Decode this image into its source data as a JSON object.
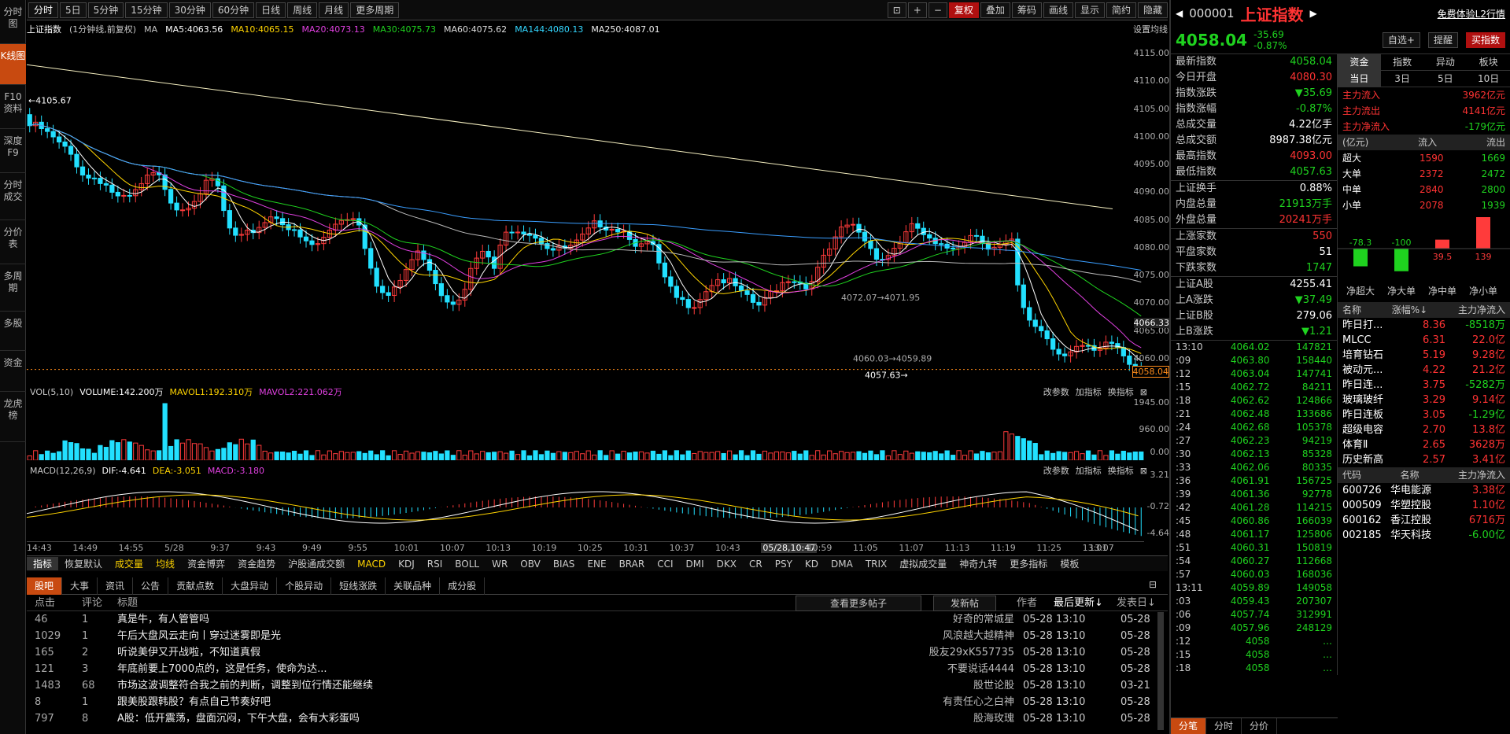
{
  "vtabs": [
    "分时图",
    "K线图",
    "F10资料",
    "深度F9",
    "分时成交",
    "分价表",
    "多周期",
    "多股",
    "资金",
    "龙虎榜"
  ],
  "toolbar": {
    "periods": [
      "分时",
      "5日",
      "5分钟",
      "15分钟",
      "30分钟",
      "60分钟",
      "日线",
      "周线",
      "月线",
      "更多周期"
    ],
    "right": [
      "复权",
      "叠加",
      "筹码",
      "画线",
      "显示",
      "简约",
      "隐藏"
    ]
  },
  "chart_header": {
    "title": "上证指数",
    "subtitle": "(1分钟线,前复权)",
    "ma": "MA",
    "ma5": "MA5:4063.56",
    "ma10": "MA10:4065.15",
    "ma20": "MA20:4073.13",
    "ma30": "MA30:4075.73",
    "ma60": "MA60:4075.62",
    "ma144": "MA144:4080.13",
    "ma250": "MA250:4087.01",
    "settings": "设置均线"
  },
  "vol_header": {
    "vol": "VOL(5,10)",
    "volume": "VOLUME:142.200万",
    "mavol1": "MAVOL1:192.310万",
    "mavol2": "MAVOL2:221.062万",
    "change_param": "改参数",
    "add_ind": "加指标",
    "swap_ind": "换指标"
  },
  "macd_header": {
    "macd": "MACD(12,26,9)",
    "dif": "DIF:-4.641",
    "dea": "DEA:-3.051",
    "macdv": "MACD:-3.180",
    "change_param": "改参数",
    "add_ind": "加指标",
    "swap_ind": "换指标"
  },
  "price_axis": [
    "4115.00",
    "4110.00",
    "4105.00",
    "4100.00",
    "4095.00",
    "4090.00",
    "4085.00",
    "4080.00",
    "4075.00",
    "4070.00",
    "4065.00",
    "4060.00"
  ],
  "price_tags": {
    "cur": "4066.33",
    "last": "4058.04"
  },
  "annotations": {
    "high": "4105.67",
    "mid": "4072.07→4071.95",
    "low1": "4060.03→4059.89",
    "low2": "4057.63→"
  },
  "vol_axis": [
    "1945.00",
    "960.00",
    "0.00"
  ],
  "macd_axis": [
    "3.21",
    "-0.72",
    "-4.64"
  ],
  "time_axis": [
    "14:43",
    "14:49",
    "14:55",
    "5/28",
    "9:37",
    "9:43",
    "9:49",
    "9:55",
    "10:01",
    "10:07",
    "10:13",
    "10:19",
    "10:25",
    "10:31",
    "10:37",
    "10:43",
    "05/28,10:47",
    "10:59",
    "11:05",
    "11:07",
    "11:13",
    "11:19",
    "11:25",
    "13:01",
    "13:07"
  ],
  "indicators": [
    "指标",
    "恢复默认",
    "成交量",
    "均线",
    "资金博弈",
    "资金趋势",
    "沪股通成交额",
    "MACD",
    "KDJ",
    "RSI",
    "BOLL",
    "WR",
    "OBV",
    "BIAS",
    "ENE",
    "BRAR",
    "CCI",
    "DMI",
    "DKX",
    "CR",
    "PSY",
    "KD",
    "DMA",
    "TRIX",
    "虚拟成交量",
    "神奇九转",
    "更多指标",
    "模板"
  ],
  "forum": {
    "tabs": [
      "股吧",
      "大事",
      "资讯",
      "公告",
      "贡献点数",
      "大盘异动",
      "个股异动",
      "短线涨跌",
      "关联品种",
      "成分股"
    ],
    "cols": {
      "clicks": "点击",
      "comments": "评论",
      "title": "标题",
      "author": "作者",
      "updated": "最后更新↓",
      "posted": "发表日↓"
    },
    "more": "查看更多帖子",
    "post_btn": "发新帖",
    "posts": [
      {
        "clicks": "46",
        "comments": "1",
        "title": "真是牛，有人管管吗",
        "author": "好奇的常城星",
        "updated": "05-28 13:10",
        "posted": "05-28"
      },
      {
        "clicks": "1029",
        "comments": "1",
        "title": "午后大盘风云走向丨穿过迷雾即是光",
        "author": "风浪越大越精神",
        "updated": "05-28 13:10",
        "posted": "05-28"
      },
      {
        "clicks": "165",
        "comments": "2",
        "title": "听说美伊又开战啦，不知道真假",
        "author": "股友29xK557735",
        "updated": "05-28 13:10",
        "posted": "05-28"
      },
      {
        "clicks": "121",
        "comments": "3",
        "title": "年底前要上7000点的，这是任务，使命为达...",
        "author": "不要说话4444",
        "updated": "05-28 13:10",
        "posted": "05-28"
      },
      {
        "clicks": "1483",
        "comments": "68",
        "title": "市场这波调整符合我之前的判断，调整到位行情还能继续",
        "author": "股世论股",
        "updated": "05-28 13:10",
        "posted": "03-21"
      },
      {
        "clicks": "8",
        "comments": "1",
        "title": "跟美股跟韩股？有点自己节奏好吧",
        "author": "有责任心之白神",
        "updated": "05-28 13:10",
        "posted": "05-28"
      },
      {
        "clicks": "797",
        "comments": "8",
        "title": "A股：低开震荡，盘面沉闷，下午大盘，会有大彩蛋吗",
        "author": "股海玫瑰",
        "updated": "05-28 13:10",
        "posted": "05-28"
      }
    ]
  },
  "quote": {
    "code": "000001",
    "name": "上证指数",
    "price": "4058.04",
    "chg": "-35.69",
    "pct": "-0.87%",
    "l2": "免费体验L2行情",
    "fav": "自选+",
    "alert": "提醒",
    "buy": "买指数",
    "rows1": [
      [
        "最新指数",
        "4058.04"
      ],
      [
        "今日开盘",
        "4080.30"
      ],
      [
        "指数涨跌",
        "▼35.69"
      ],
      [
        "指数涨幅",
        "-0.87%"
      ],
      [
        "总成交量",
        "4.22亿手"
      ],
      [
        "总成交额",
        "8987.38亿元"
      ],
      [
        "最高指数",
        "4093.00"
      ],
      [
        "最低指数",
        "4057.63"
      ]
    ],
    "rows2": [
      [
        "上证换手",
        "0.88%"
      ],
      [
        "内盘总量",
        "21913万手"
      ],
      [
        "外盘总量",
        "20241万手"
      ]
    ],
    "rows3": [
      [
        "上涨家数",
        "550"
      ],
      [
        "平盘家数",
        "51"
      ],
      [
        "下跌家数",
        "1747"
      ]
    ],
    "rows4": [
      [
        "上证A股",
        "4255.41"
      ],
      [
        "上A涨跌",
        "▼37.49"
      ],
      [
        "上证B股",
        "279.06"
      ],
      [
        "上B涨跌",
        "▼1.21"
      ]
    ]
  },
  "fund": {
    "tabs": [
      "资金",
      "指数",
      "异动",
      "板块"
    ],
    "subtabs": [
      "当日",
      "3日",
      "5日",
      "10日"
    ],
    "flows": [
      [
        "主力流入",
        "3962亿元"
      ],
      [
        "主力流出",
        "4141亿元"
      ],
      [
        "主力净流入",
        "-179亿元"
      ]
    ],
    "head": [
      "(亿元)",
      "流入",
      "流出"
    ],
    "table": [
      [
        "超大",
        "1590",
        "1669"
      ],
      [
        "大单",
        "2372",
        "2472"
      ],
      [
        "中单",
        "2840",
        "2800"
      ],
      [
        "小单",
        "2078",
        "1939"
      ]
    ],
    "bars": [
      {
        "label": "净超大",
        "value": -78.3
      },
      {
        "label": "净大单",
        "value": -100
      },
      {
        "label": "净中单",
        "value": 39.5
      },
      {
        "label": "净小单",
        "value": 139
      }
    ],
    "list_head": [
      "名称",
      "涨幅%↓",
      "主力净流入"
    ],
    "list": [
      [
        "昨日打...",
        "8.36",
        "-8518万"
      ],
      [
        "MLCC",
        "6.31",
        "22.0亿"
      ],
      [
        "培育钻石",
        "5.19",
        "9.28亿"
      ],
      [
        "被动元...",
        "4.22",
        "21.2亿"
      ],
      [
        "昨日连...",
        "3.75",
        "-5282万"
      ],
      [
        "玻璃玻纤",
        "3.29",
        "9.14亿"
      ],
      [
        "昨日连板",
        "3.05",
        "-1.29亿"
      ],
      [
        "超级电容",
        "2.70",
        "13.8亿"
      ],
      [
        "体育Ⅱ",
        "2.65",
        "3628万"
      ],
      [
        "历史新高",
        "2.57",
        "3.41亿"
      ]
    ],
    "stock_head": [
      "代码",
      "名称",
      "主力净流入"
    ],
    "stocks": [
      [
        "600726",
        "华电能源",
        "3.38亿"
      ],
      [
        "000509",
        "华塑控股",
        "1.10亿"
      ],
      [
        "600162",
        "香江控股",
        "6716万"
      ],
      [
        "002185",
        "华天科技",
        "-6.00亿"
      ]
    ]
  },
  "ticks": [
    [
      "13:10",
      "4064.02",
      "147821"
    ],
    [
      ":09",
      "4063.80",
      "158440"
    ],
    [
      ":12",
      "4063.04",
      "147741"
    ],
    [
      ":15",
      "4062.72",
      "84211"
    ],
    [
      ":18",
      "4062.62",
      "124866"
    ],
    [
      ":21",
      "4062.48",
      "133686"
    ],
    [
      ":24",
      "4062.68",
      "105378"
    ],
    [
      ":27",
      "4062.23",
      "94219"
    ],
    [
      ":30",
      "4062.13",
      "85328"
    ],
    [
      ":33",
      "4062.06",
      "80335"
    ],
    [
      ":36",
      "4061.91",
      "156725"
    ],
    [
      ":39",
      "4061.36",
      "92778"
    ],
    [
      ":42",
      "4061.28",
      "114215"
    ],
    [
      ":45",
      "4060.86",
      "166039"
    ],
    [
      ":48",
      "4061.17",
      "125806"
    ],
    [
      ":51",
      "4060.31",
      "150819"
    ],
    [
      ":54",
      "4060.27",
      "112668"
    ],
    [
      ":57",
      "4060.03",
      "168036"
    ],
    [
      "13:11",
      "4059.89",
      "149058"
    ],
    [
      ":03",
      "4059.43",
      "207307"
    ],
    [
      ":06",
      "4057.74",
      "312991"
    ],
    [
      ":09",
      "4057.96",
      "248129"
    ],
    [
      ":12",
      "4058",
      "…"
    ],
    [
      ":15",
      "4058",
      "…"
    ],
    [
      ":18",
      "4058",
      "…"
    ]
  ],
  "bottom_tabs": [
    "分笔",
    "分时",
    "分价"
  ]
}
